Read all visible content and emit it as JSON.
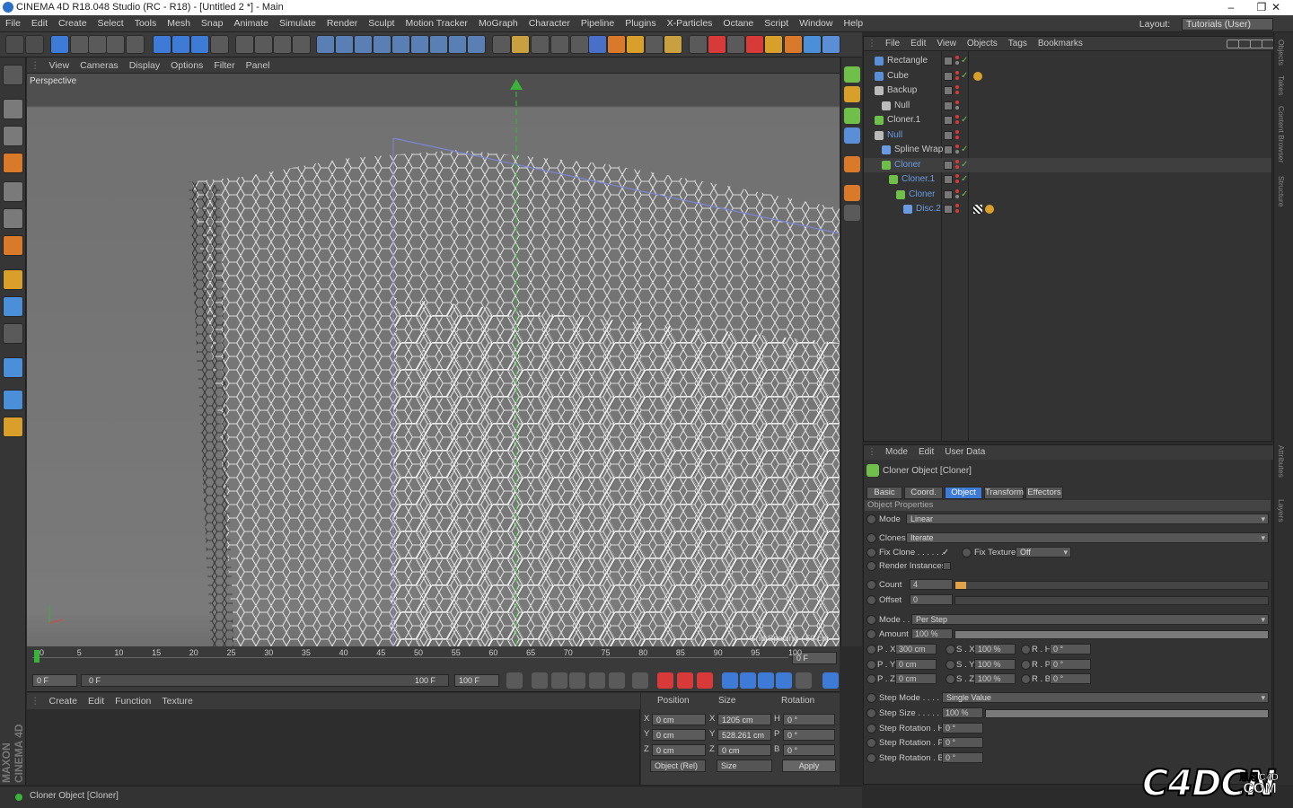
{
  "window": {
    "title": "CINEMA 4D R18.048 Studio (RC - R18) - [Untitled 2 *] - Main",
    "minimize": "–",
    "maximize": "❐",
    "close": "✕",
    "layout_label": "Layout:",
    "layout_value": "Tutorials (User)"
  },
  "main_menu": [
    "File",
    "Edit",
    "Create",
    "Select",
    "Tools",
    "Mesh",
    "Snap",
    "Animate",
    "Simulate",
    "Render",
    "Sculpt",
    "Motion Tracker",
    "MoGraph",
    "Character",
    "Pipeline",
    "Plugins",
    "X-Particles",
    "Octane",
    "Script",
    "Window",
    "Help"
  ],
  "viewport": {
    "menu": [
      "View",
      "Cameras",
      "Display",
      "Options",
      "Filter",
      "Panel"
    ],
    "label": "Perspective",
    "grid_spacing": "Grid Spacing : 50 cm"
  },
  "timeline": {
    "ticks": [
      "0",
      "5",
      "10",
      "15",
      "20",
      "25",
      "30",
      "35",
      "40",
      "45",
      "50",
      "55",
      "60",
      "65",
      "70",
      "75",
      "80",
      "85",
      "90",
      "95",
      "100"
    ],
    "current_frame": "0 F",
    "start_frame": "0 F",
    "range_start": "0 F",
    "range_end": "100 F",
    "end_frame": "100 F"
  },
  "material_manager": {
    "menu": [
      "Create",
      "Edit",
      "Function",
      "Texture"
    ]
  },
  "coordinates": {
    "headers": [
      "Position",
      "Size",
      "Rotation"
    ],
    "rows": [
      {
        "axis": "X",
        "pos": "0 cm",
        "size_axis": "X",
        "size": "1205 cm",
        "rot_axis": "H",
        "rot": "0 °"
      },
      {
        "axis": "Y",
        "pos": "0 cm",
        "size_axis": "Y",
        "size": "528.261 cm",
        "rot_axis": "P",
        "rot": "0 °"
      },
      {
        "axis": "Z",
        "pos": "0 cm",
        "size_axis": "Z",
        "size": "0 cm",
        "rot_axis": "B",
        "rot": "0 °"
      }
    ],
    "mode": "Object (Rel)",
    "size_mode": "Size",
    "apply": "Apply"
  },
  "status": "Cloner Object [Cloner]",
  "object_manager": {
    "menu": [
      "File",
      "Edit",
      "View",
      "Objects",
      "Tags",
      "Bookmarks"
    ],
    "objects": [
      {
        "name": "Rectangle",
        "indent": 0,
        "color": "#c8c8c8",
        "icon": "#5a8fd8"
      },
      {
        "name": "Cube",
        "indent": 0,
        "color": "#c8c8c8",
        "icon": "#5a8fd8"
      },
      {
        "name": "Backup",
        "indent": 0,
        "color": "#c8c8c8",
        "icon": "#bbbbbb"
      },
      {
        "name": "Null",
        "indent": 1,
        "color": "#c8c8c8",
        "icon": "#bbbbbb"
      },
      {
        "name": "Cloner.1",
        "indent": 0,
        "color": "#c8c8c8",
        "icon": "#6fbf4a"
      },
      {
        "name": "Null",
        "indent": 0,
        "color": "#6a9be0",
        "icon": "#bbbbbb"
      },
      {
        "name": "Spline Wrap",
        "indent": 1,
        "color": "#c8c8c8",
        "icon": "#6a9be0"
      },
      {
        "name": "Cloner",
        "indent": 1,
        "color": "#6a9be0",
        "icon": "#6fbf4a"
      },
      {
        "name": "Cloner.1",
        "indent": 2,
        "color": "#6a9be0",
        "icon": "#6fbf4a"
      },
      {
        "name": "Cloner",
        "indent": 3,
        "color": "#6a9be0",
        "icon": "#6fbf4a"
      },
      {
        "name": "Disc.2",
        "indent": 4,
        "color": "#6a9be0",
        "icon": "#6a9be0"
      }
    ]
  },
  "attribute_manager": {
    "menu": [
      "Mode",
      "Edit",
      "User Data"
    ],
    "object_title": "Cloner Object [Cloner]",
    "tabs": [
      "Basic",
      "Coord.",
      "Object",
      "Transform",
      "Effectors"
    ],
    "active_tab": "Object",
    "section": "Object Properties",
    "mode_label": "Mode",
    "mode_value": "Linear",
    "clones_label": "Clones",
    "clones_value": "Iterate",
    "fix_clone_label": "Fix Clone . . . . . .",
    "fix_clone_check": "✓",
    "fix_texture_label": "Fix Texture",
    "fix_texture_value": "Off",
    "render_instances_label": "Render Instances",
    "count_label": "Count",
    "count_value": "4",
    "offset_label": "Offset",
    "offset_value": "0",
    "mode2_label": "Mode . .",
    "mode2_value": "Per Step",
    "amount_label": "Amount",
    "amount_value": "100 %",
    "amount_level": 1.0,
    "px_label": "P . X",
    "px": "300 cm",
    "sx_label": "S . X",
    "sx": "100 %",
    "rh_label": "R . H",
    "rh": "0 °",
    "py_label": "P . Y",
    "py": "0 cm",
    "sy_label": "S . Y",
    "sy": "100 %",
    "rp_label": "R . P",
    "rp": "0 °",
    "pz_label": "P . Z",
    "pz": "0 cm",
    "sz_label": "S . Z",
    "sz": "100 %",
    "rb_label": "R . B",
    "rb": "0 °",
    "step_mode_label": "Step Mode . . . . .",
    "step_mode_value": "Single Value",
    "step_size_label": "Step Size . . . . . .",
    "step_size_value": "100 %",
    "step_rot_h_label": "Step Rotation . H",
    "step_rot_h": "0 °",
    "step_rot_p_label": "Step Rotation . P",
    "step_rot_p": "0 °",
    "step_rot_b_label": "Step Rotation . B",
    "step_rot_b": "0 °"
  },
  "right_strip": [
    "Objects",
    "Takes",
    "Content Browser",
    "Structure",
    "Attributes",
    "Layers"
  ],
  "watermark": {
    "main": "C4DCN",
    "small1": "恩恩C4D",
    "small2": ".COM"
  }
}
